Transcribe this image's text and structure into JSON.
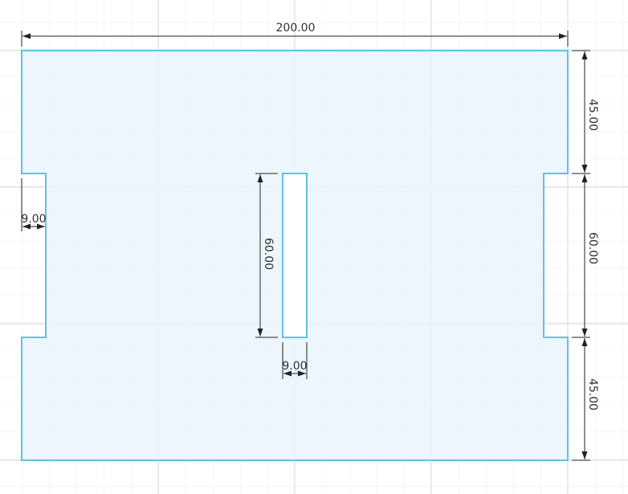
{
  "colors": {
    "background": "#ffffff",
    "grid_minor": "#ececec",
    "grid_major": "#d9d9d9",
    "profile_fill": "#eef7fc",
    "profile_stroke": "#5bc3e8",
    "dimension": "#222222"
  },
  "dimensions": {
    "overall_width": "200.00",
    "top_height": "45.00",
    "middle_height": "60.00",
    "bottom_height": "45.00",
    "left_notch_depth": "9.00",
    "slot_height": "60.00",
    "slot_width": "9.00"
  }
}
